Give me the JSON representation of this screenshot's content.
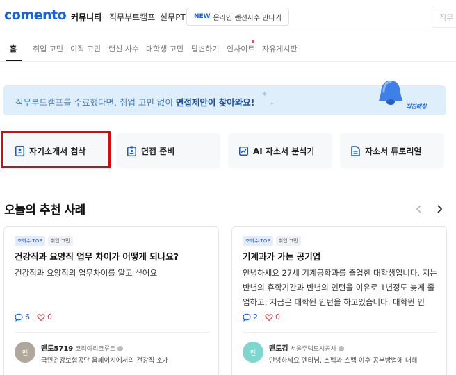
{
  "header": {
    "logo": "comento",
    "nav": [
      "커뮤니티",
      "직무부트캠프",
      "실무PT"
    ],
    "promo_badge": "NEW",
    "promo_text": "온라인 랜선사수 만나기",
    "search_placeholder": "직무"
  },
  "subnav": {
    "items": [
      "홈",
      "취업 고민",
      "이직 고민",
      "랜선 사수",
      "대학생 고민",
      "답변하기",
      "인사이트",
      "자유게시판"
    ]
  },
  "banner": {
    "text_before": "직무부트캠프를 수료했다면, 취업 고민 없이 ",
    "text_bold": "면접제안이 찾아와요!",
    "label": "직진매칭"
  },
  "quick_buttons": [
    {
      "label": "자기소개서 첨삭",
      "icon": "document-person-icon"
    },
    {
      "label": "면접 준비",
      "icon": "clipboard-icon"
    },
    {
      "label": "AI 자소서 분석기",
      "icon": "chart-icon"
    },
    {
      "label": "자소서 튜토리얼",
      "icon": "file-icon"
    }
  ],
  "section": {
    "title": "오늘의 추천 사례"
  },
  "cards": [
    {
      "tags": [
        "조회수 TOP",
        "취업 고민"
      ],
      "title": "건강직과 요양직 업무 차이가 어떻게 되나요?",
      "body": "건강직과 요양직의 업무차이를 알고 싶어요",
      "comments": "6",
      "likes": "0",
      "avatar_text": "멘",
      "mentor_name": "멘토5719",
      "mentor_company": "코리아리크루트",
      "mentor_desc": "국민건강보험공단 홈페이지에서의 건강직 소개"
    },
    {
      "tags": [
        "조회수 TOP",
        "취업 고민"
      ],
      "title": "기계과가 가는 공기업",
      "body": "안녕하세요 27세 기계공학과를 졸업한 대학생입니다. 저는 반년의 휴학기간과 반년의 인턴을 이유로 1년정도 늦게 졸업하고, 지금은 대학원 인턴을 하고있습니다. 대학원 인",
      "comments": "2",
      "likes": "0",
      "avatar_text": "멘",
      "mentor_name": "멘토킹",
      "mentor_company": "서울주택도시공사",
      "mentor_desc": "안녕하세요 멘티님, 스펙과 스펙 이후 공부방법에 대해"
    }
  ],
  "colors": {
    "brand": "#1560e8",
    "highlight": "#e8000b",
    "banner_bg": "#dfeefb",
    "avatar_1": "#b0a79d",
    "avatar_2": "#7fd6cf"
  }
}
